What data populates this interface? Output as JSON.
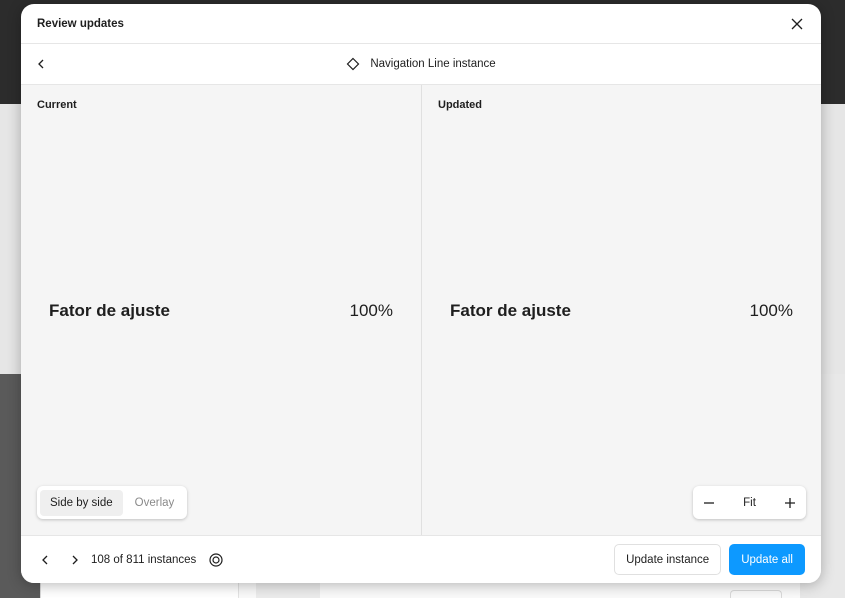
{
  "modal": {
    "title": "Review updates",
    "component_name": "Navigation Line instance"
  },
  "panes": {
    "current": {
      "label": "Current",
      "preview_label": "Fator de ajuste",
      "preview_value": "100%"
    },
    "updated": {
      "label": "Updated",
      "preview_label": "Fator de ajuste",
      "preview_value": "100%"
    }
  },
  "view_modes": {
    "options": [
      "Side by side",
      "Overlay"
    ],
    "selected": "Side by side"
  },
  "zoom": {
    "level": "Fit"
  },
  "footer": {
    "instance_count": "108 of 811 instances",
    "update_instance_label": "Update instance",
    "update_all_label": "Update all"
  },
  "icons": {
    "close": "close-icon",
    "back": "chevron-left-icon",
    "component": "component-diamond-icon",
    "prev": "chevron-left-icon",
    "next": "chevron-right-icon",
    "target": "target-icon",
    "zoom_out": "minus-icon",
    "zoom_in": "plus-icon"
  },
  "colors": {
    "primary": "#0d99ff",
    "canvas": "#f5f5f5",
    "text": "#1e1e1e"
  }
}
